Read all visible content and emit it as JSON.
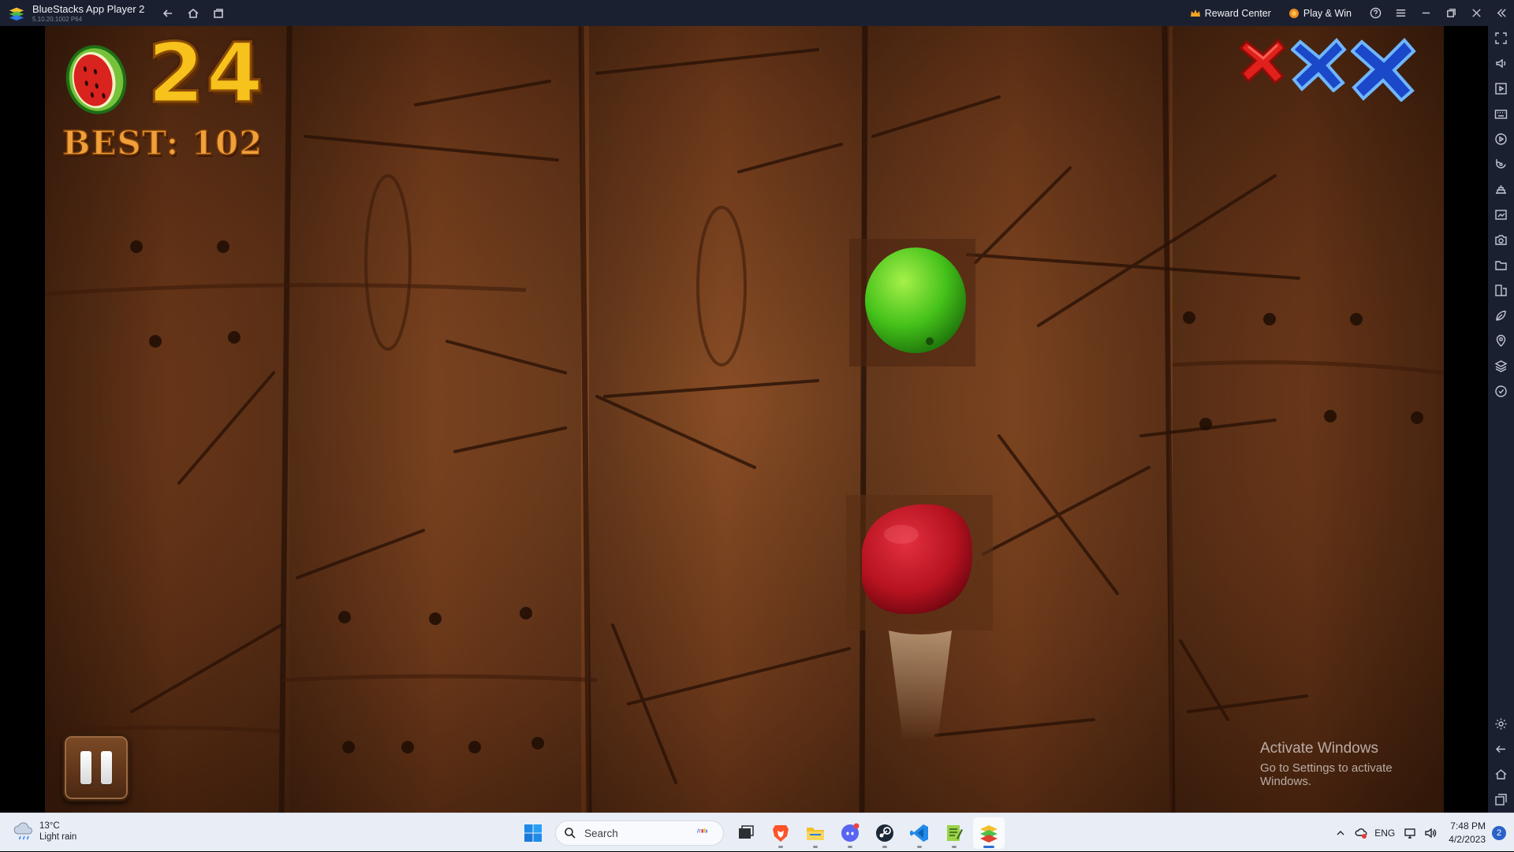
{
  "window": {
    "title": "BlueStacks App Player 2",
    "version": "5.10.20.1002  P64",
    "reward_center": "Reward Center",
    "play_win": "Play & Win"
  },
  "game": {
    "score": "24",
    "best": "BEST: 102",
    "strikes": [
      {
        "state": "used",
        "color": "#e0201a"
      },
      {
        "state": "remaining",
        "color": "#1b48c9"
      },
      {
        "state": "remaining",
        "color": "#1b48c9"
      }
    ],
    "fruits_on_screen": [
      "lime",
      "apple"
    ]
  },
  "watermark": {
    "title": "Activate Windows",
    "subtitle": "Go to Settings to activate Windows."
  },
  "sidebar_icons": [
    "fullscreen-icon",
    "volume-icon",
    "media-icon",
    "keyboard-icon",
    "record-icon",
    "rotate-icon",
    "shake-icon",
    "screenshot-icon",
    "camera-icon",
    "folder-icon",
    "install-apk-icon",
    "eco-mode-icon",
    "location-icon",
    "layers-icon",
    "sync-icon",
    "settings-icon",
    "back-icon",
    "home-icon",
    "recent-apps-icon"
  ],
  "taskbar": {
    "weather_temp": "13°C",
    "weather_desc": "Light rain",
    "search_placeholder": "Search",
    "apps": [
      "start",
      "search",
      "task-view",
      "brave",
      "file-explorer",
      "discord",
      "steam",
      "vscode",
      "notepad-plus",
      "bluestacks"
    ],
    "language": "ENG",
    "time": "7:48 PM",
    "date": "4/2/2023",
    "notifications": "2"
  },
  "colors": {
    "titlebar_bg": "#1b2030",
    "score_gold": "#f6c21b",
    "best_orange": "#f0a03a",
    "taskbar_bg": "#e9eef6"
  }
}
